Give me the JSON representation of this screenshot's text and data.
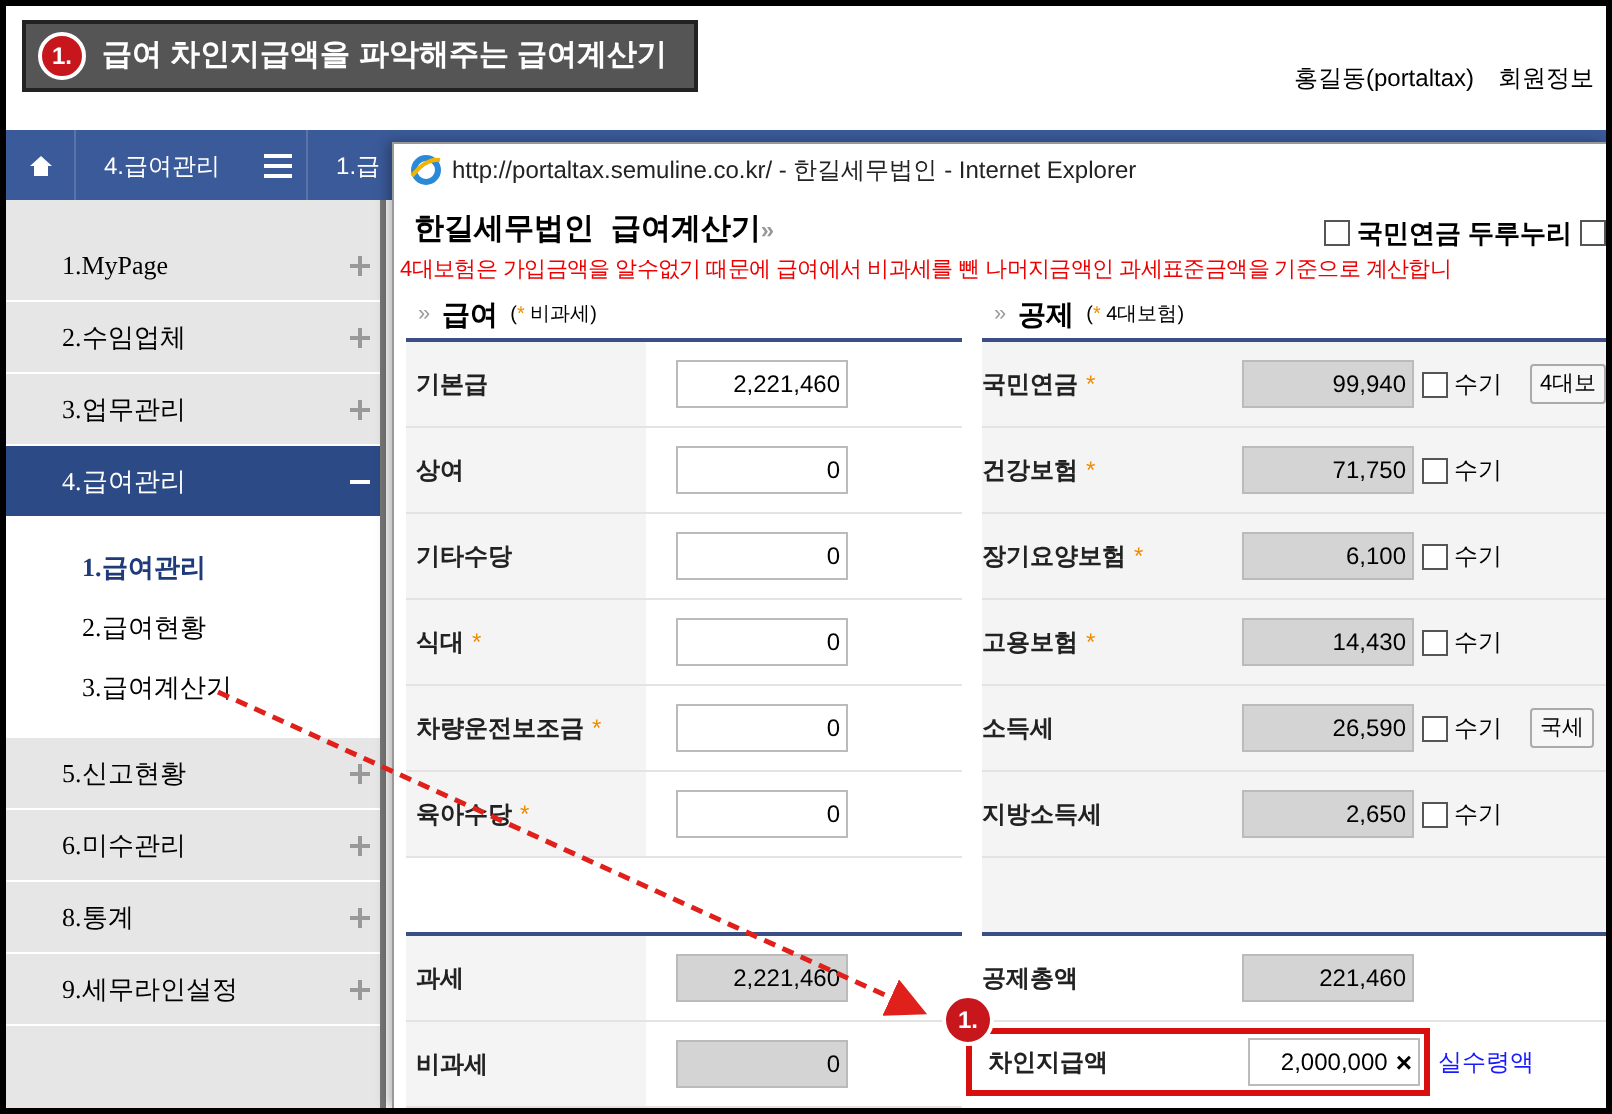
{
  "callout": {
    "badge": "1.",
    "text": "급여 차인지급액을 파악해주는 급여계산기"
  },
  "header": {
    "user": "홍길동(portaltax)",
    "member_link": "회원정보"
  },
  "navbar": {
    "items": [
      {
        "kind": "home"
      },
      {
        "kind": "text",
        "label": "4.급여관리"
      },
      {
        "kind": "menu"
      },
      {
        "kind": "text",
        "label": "1.급"
      }
    ]
  },
  "sidebar": {
    "items": [
      {
        "label": "1.MyPage",
        "expanded": false
      },
      {
        "label": "2.수임업체",
        "expanded": false
      },
      {
        "label": "3.업무관리",
        "expanded": false
      },
      {
        "label": "4.급여관리",
        "expanded": true,
        "children": [
          {
            "label": "1.급여관리",
            "selected": true
          },
          {
            "label": "2.급여현황",
            "selected": false
          },
          {
            "label": "3.급여계산기",
            "selected": false
          }
        ]
      },
      {
        "label": "5.신고현황",
        "expanded": false
      },
      {
        "label": "6.미수관리",
        "expanded": false
      },
      {
        "label": "8.통계",
        "expanded": false
      },
      {
        "label": "9.세무라인설정",
        "expanded": false
      }
    ]
  },
  "popup": {
    "title_bar": "http://portaltax.semuline.co.kr/ - 한길세무법인 - Internet Explorer",
    "heading": "한길세무법인  급여계산기",
    "heading_arrow": "»",
    "options": [
      {
        "label": "국민연금 두루누리",
        "checked": false
      },
      {
        "checked": false
      }
    ],
    "notice": "4대보험은 가입금액을 알수없기 때문에 급여에서 비과세를 뺀 나머지금액인 과세표준금액을 기준으로 계산합니",
    "pay": {
      "section": "급여",
      "note_open": "(",
      "note_star": "*",
      "note": "비과세",
      "note_close": ")",
      "rows": [
        {
          "label": "기본급",
          "star": false,
          "value": "2,221,460"
        },
        {
          "label": "상여",
          "star": false,
          "value": "0"
        },
        {
          "label": "기타수당",
          "star": false,
          "value": "0"
        },
        {
          "label": "식대",
          "star": true,
          "value": "0"
        },
        {
          "label": "차량운전보조금",
          "star": true,
          "value": "0"
        },
        {
          "label": "육아수당",
          "star": true,
          "value": "0"
        }
      ],
      "totals": [
        {
          "label": "과세",
          "value": "2,221,460"
        },
        {
          "label": "비과세",
          "value": "0"
        }
      ]
    },
    "deduction": {
      "section": "공제",
      "note_open": "(",
      "note_star": "*",
      "note": "4대보험",
      "note_close": ")",
      "rows": [
        {
          "label": "국민연금",
          "star": true,
          "value": "99,940",
          "manual_label": "수기",
          "manual": false,
          "button": "4대보"
        },
        {
          "label": "건강보험",
          "star": true,
          "value": "71,750",
          "manual_label": "수기",
          "manual": false
        },
        {
          "label": "장기요양보험",
          "star": true,
          "value": "6,100",
          "manual_label": "수기",
          "manual": false
        },
        {
          "label": "고용보험",
          "star": true,
          "value": "14,430",
          "manual_label": "수기",
          "manual": false
        },
        {
          "label": "소득세",
          "star": false,
          "value": "26,590",
          "manual_label": "수기",
          "manual": false,
          "button": "국세"
        },
        {
          "label": "지방소득세",
          "star": false,
          "value": "2,650",
          "manual_label": "수기",
          "manual": false
        }
      ],
      "total": {
        "label": "공제총액",
        "value": "221,460"
      },
      "net": {
        "label": "차인지급액",
        "value": "2,000,000",
        "clear": "×",
        "link": "실수령액",
        "badge": "1.",
        "highlighted": true
      }
    }
  }
}
